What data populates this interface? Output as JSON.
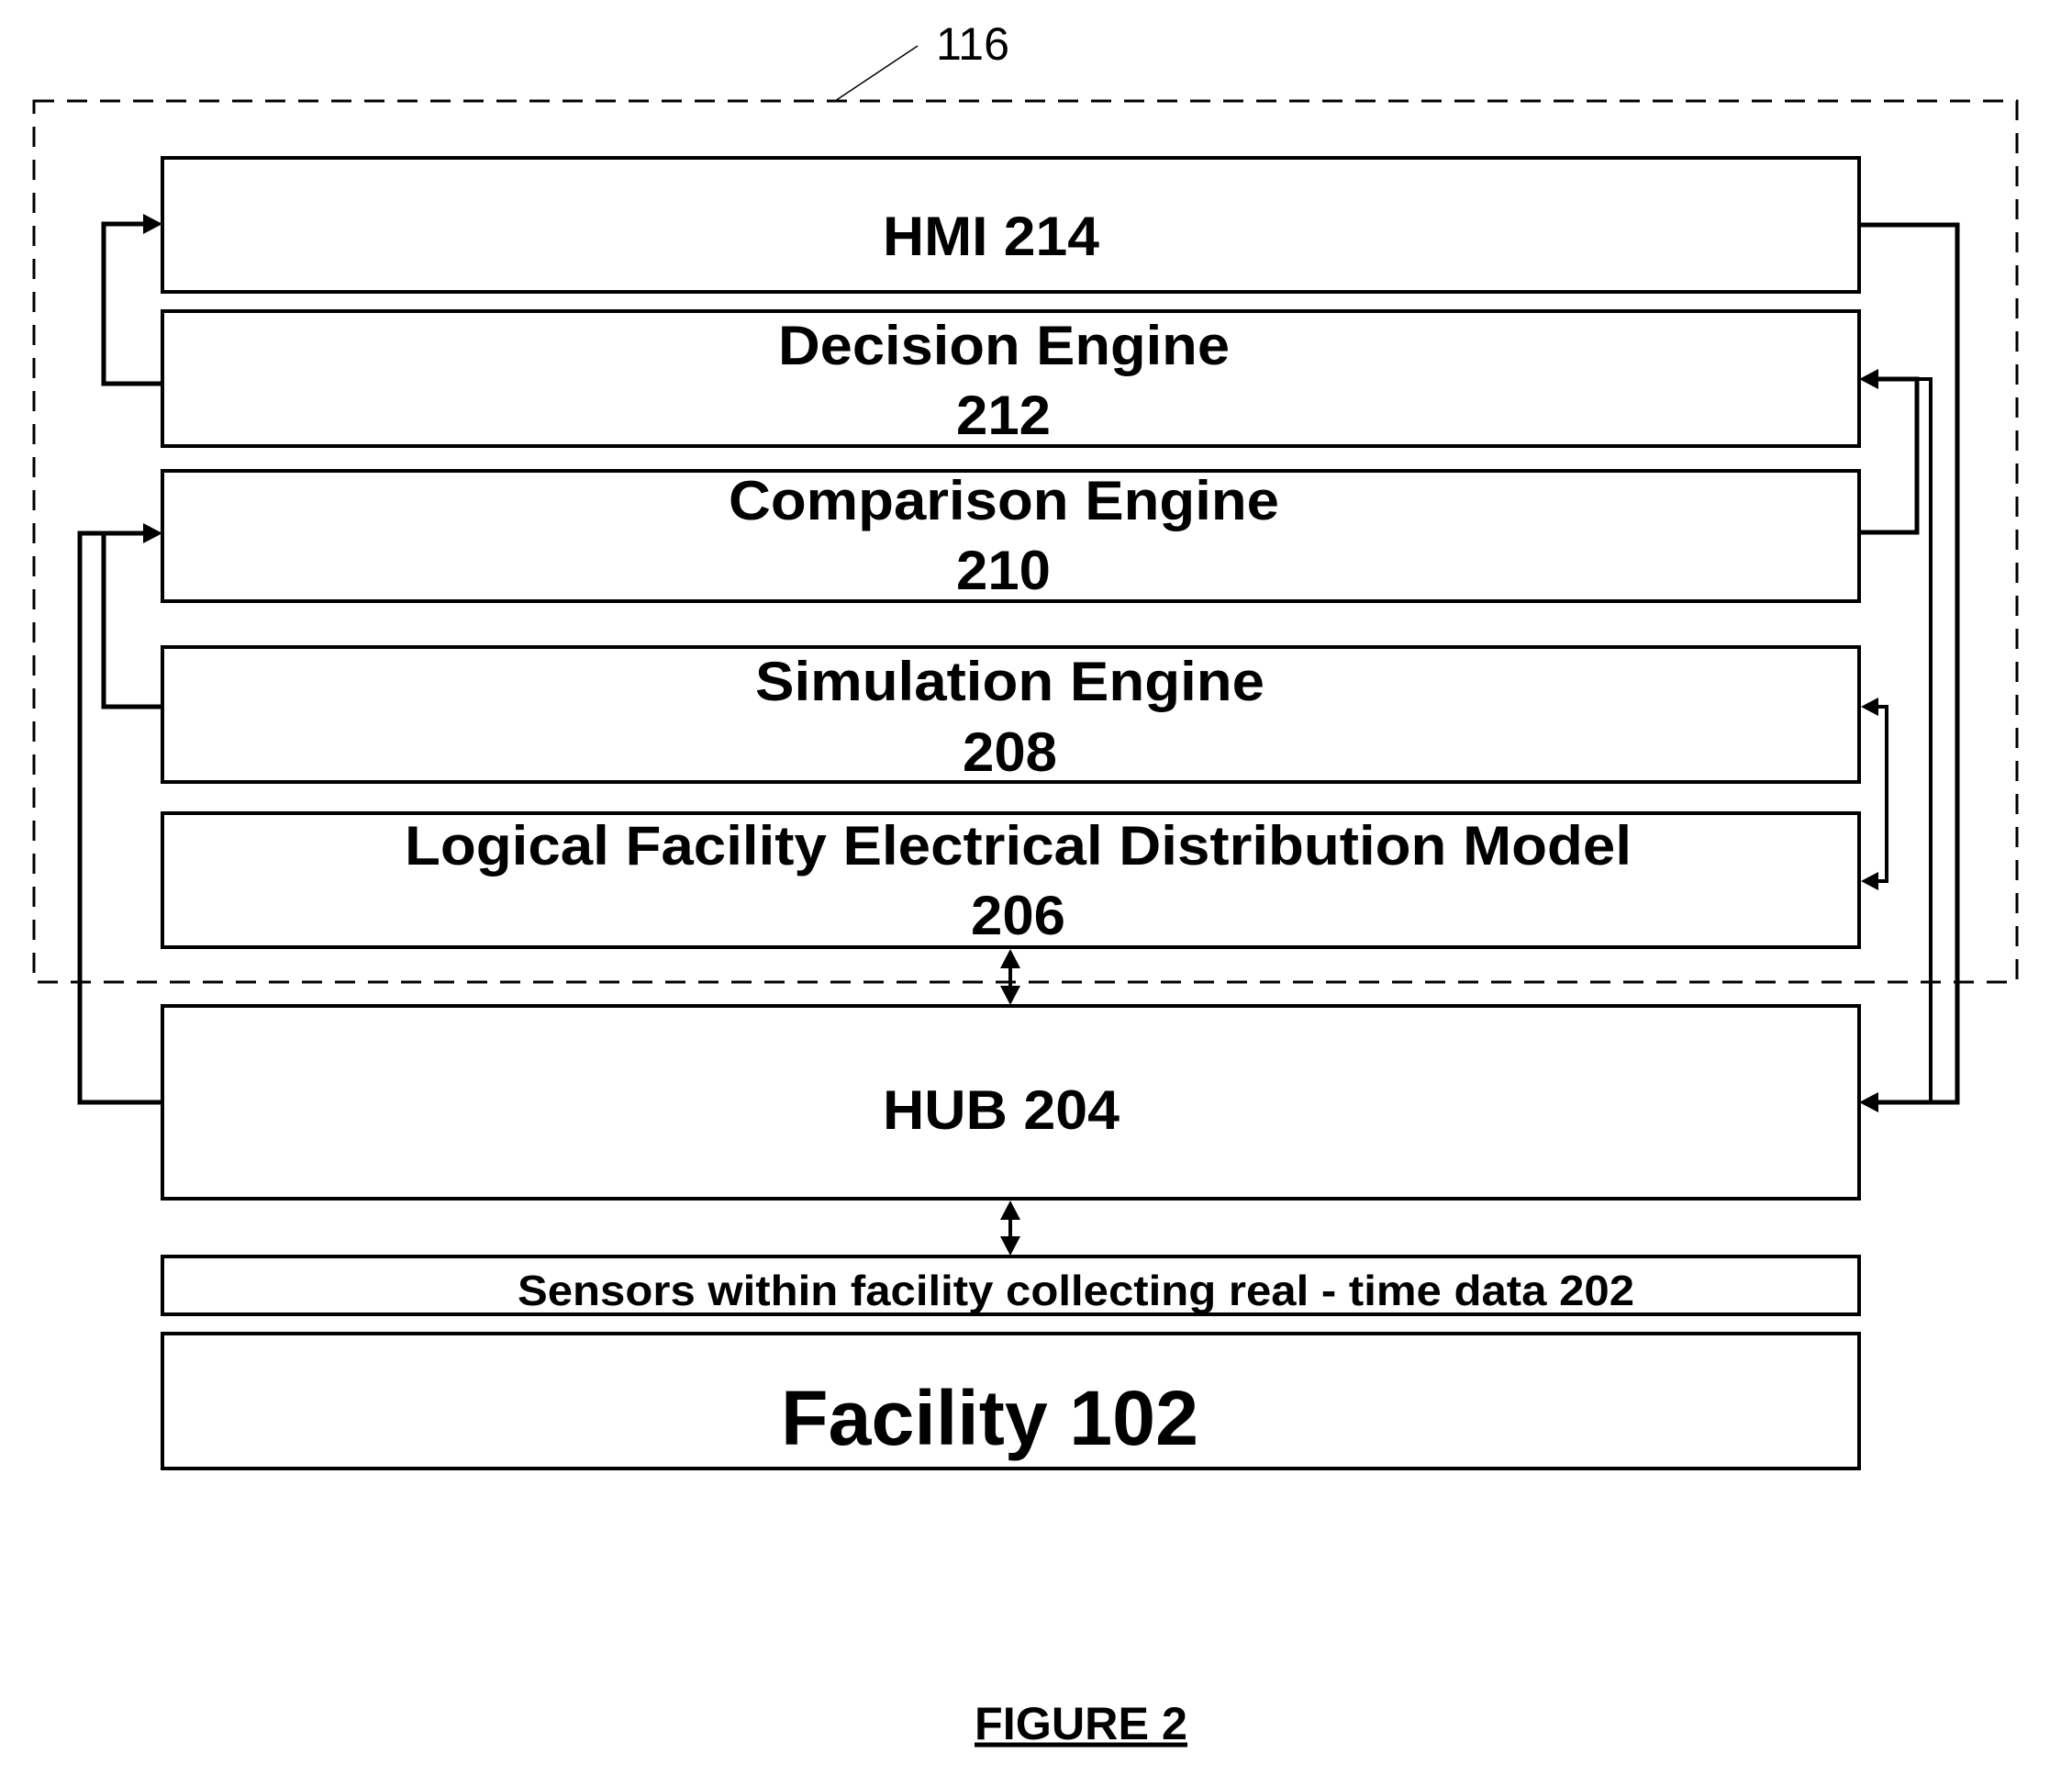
{
  "figure": {
    "caption": "FIGURE 2",
    "system_ref": "116"
  },
  "blocks": {
    "hmi": {
      "line1": "HMI 214"
    },
    "decision": {
      "line1": "Decision Engine",
      "line2": "212"
    },
    "comparison": {
      "line1": "Comparison Engine",
      "line2": "210"
    },
    "simulation": {
      "line1": "Simulation Engine",
      "line2": "208"
    },
    "model": {
      "line1": "Logical Facility Electrical Distribution Model",
      "line2": "206"
    },
    "hub": {
      "line1": "HUB 204"
    },
    "sensors": {
      "line1": "Sensors within facility collecting real - time data 202"
    },
    "facility": {
      "line1": "Facility 102"
    }
  },
  "connections": [
    {
      "from": "Decision Engine 212",
      "to": "HMI 214",
      "direction": "one-way"
    },
    {
      "from": "HMI 214",
      "to": "HUB 204",
      "direction": "one-way"
    },
    {
      "from": "Comparison Engine 210",
      "to": "Decision Engine 212",
      "direction": "one-way"
    },
    {
      "from": "HUB 204",
      "to": "Decision Engine 212",
      "direction": "one-way"
    },
    {
      "from": "Simulation Engine 208",
      "to": "Comparison Engine 210",
      "direction": "one-way"
    },
    {
      "from": "HUB 204",
      "to": "Comparison Engine 210",
      "direction": "one-way"
    },
    {
      "from": "Simulation Engine 208",
      "to": "Logical Facility Electrical Distribution Model 206",
      "direction": "two-way"
    },
    {
      "from": "Logical Facility Electrical Distribution Model 206",
      "to": "HUB 204",
      "direction": "two-way"
    },
    {
      "from": "HUB 204",
      "to": "Sensors within facility collecting real - time data 202",
      "direction": "two-way"
    }
  ]
}
